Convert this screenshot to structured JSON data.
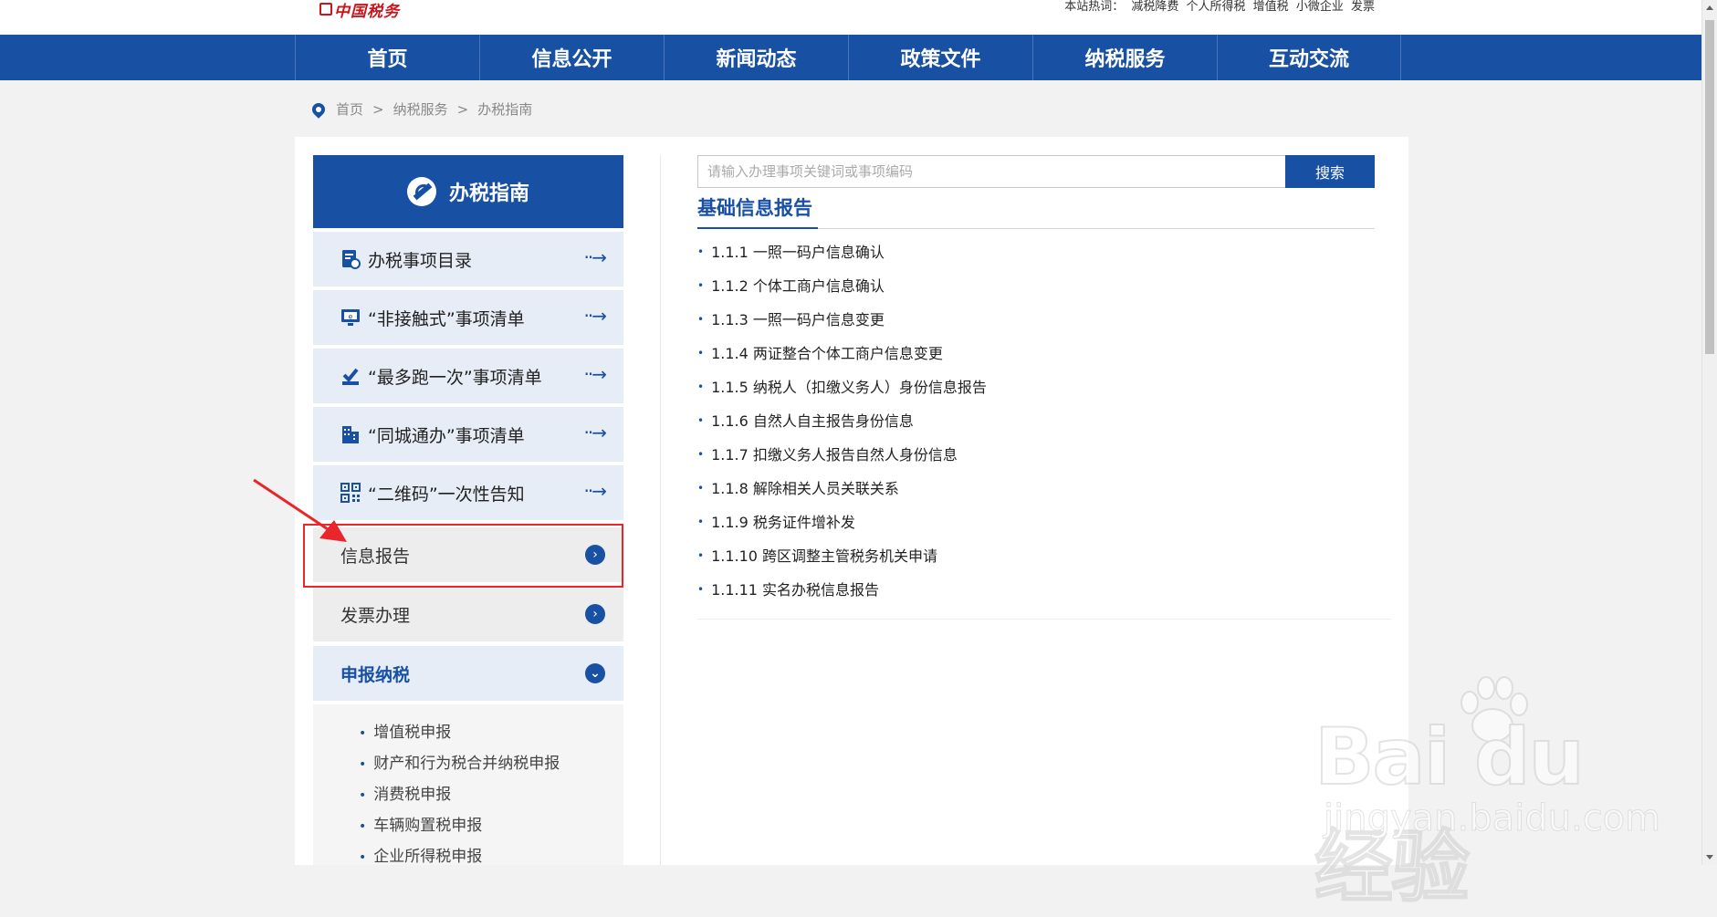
{
  "header": {
    "logo_text": "中国税务",
    "hot_label": "本站热词：",
    "hot_words": [
      "减税降费",
      "个人所得税",
      "增值税",
      "小微企业",
      "发票"
    ]
  },
  "nav": {
    "items": [
      "首页",
      "信息公开",
      "新闻动态",
      "政策文件",
      "纳税服务",
      "互动交流"
    ]
  },
  "breadcrumb": [
    "首页",
    "纳税服务",
    "办税指南"
  ],
  "breadcrumb_sep": ">",
  "sidebar": {
    "title": "办税指南",
    "quick_links": [
      {
        "label": "办税事项目录",
        "icon": "catalog-icon"
      },
      {
        "label": "“非接触式”事项清单",
        "icon": "monitor-icon"
      },
      {
        "label": "“最多跑一次”事项清单",
        "icon": "check-stamp-icon"
      },
      {
        "label": "“同城通办”事项清单",
        "icon": "building-icon"
      },
      {
        "label": "“二维码”一次性告知",
        "icon": "qrcode-icon"
      }
    ],
    "arrow_glyph": "··→",
    "categories": [
      {
        "label": "信息报告",
        "state": "collapsed"
      },
      {
        "label": "发票办理",
        "state": "collapsed"
      },
      {
        "label": "申报纳税",
        "state": "expanded"
      }
    ],
    "sub_items": [
      "增值税申报",
      "财产和行为税合并纳税申报",
      "消费税申报",
      "车辆购置税申报",
      "企业所得税申报"
    ]
  },
  "search": {
    "placeholder": "请输入办理事项关键词或事项编码",
    "button_label": "搜索"
  },
  "content": {
    "section_title": "基础信息报告",
    "items": [
      "1.1.1 一照一码户信息确认",
      "1.1.2 个体工商户信息确认",
      "1.1.3 一照一码户信息变更",
      "1.1.4 两证整合个体工商户信息变更",
      "1.1.5 纳税人（扣缴义务人）身份信息报告",
      "1.1.6 自然人自主报告身份信息",
      "1.1.7 扣缴义务人报告自然人身份信息",
      "1.1.8 解除相关人员关联关系",
      "1.1.9 税务证件增补发",
      "1.1.10 跨区调整主管税务机关申请",
      "1.1.11 实名办税信息报告"
    ]
  },
  "watermark": {
    "brand": "Bai du 经验",
    "url": "jingyan.baidu.com"
  },
  "colors": {
    "brand_blue": "#1850a3",
    "highlight_red": "#e8262b",
    "logo_red": "#c8161d"
  }
}
